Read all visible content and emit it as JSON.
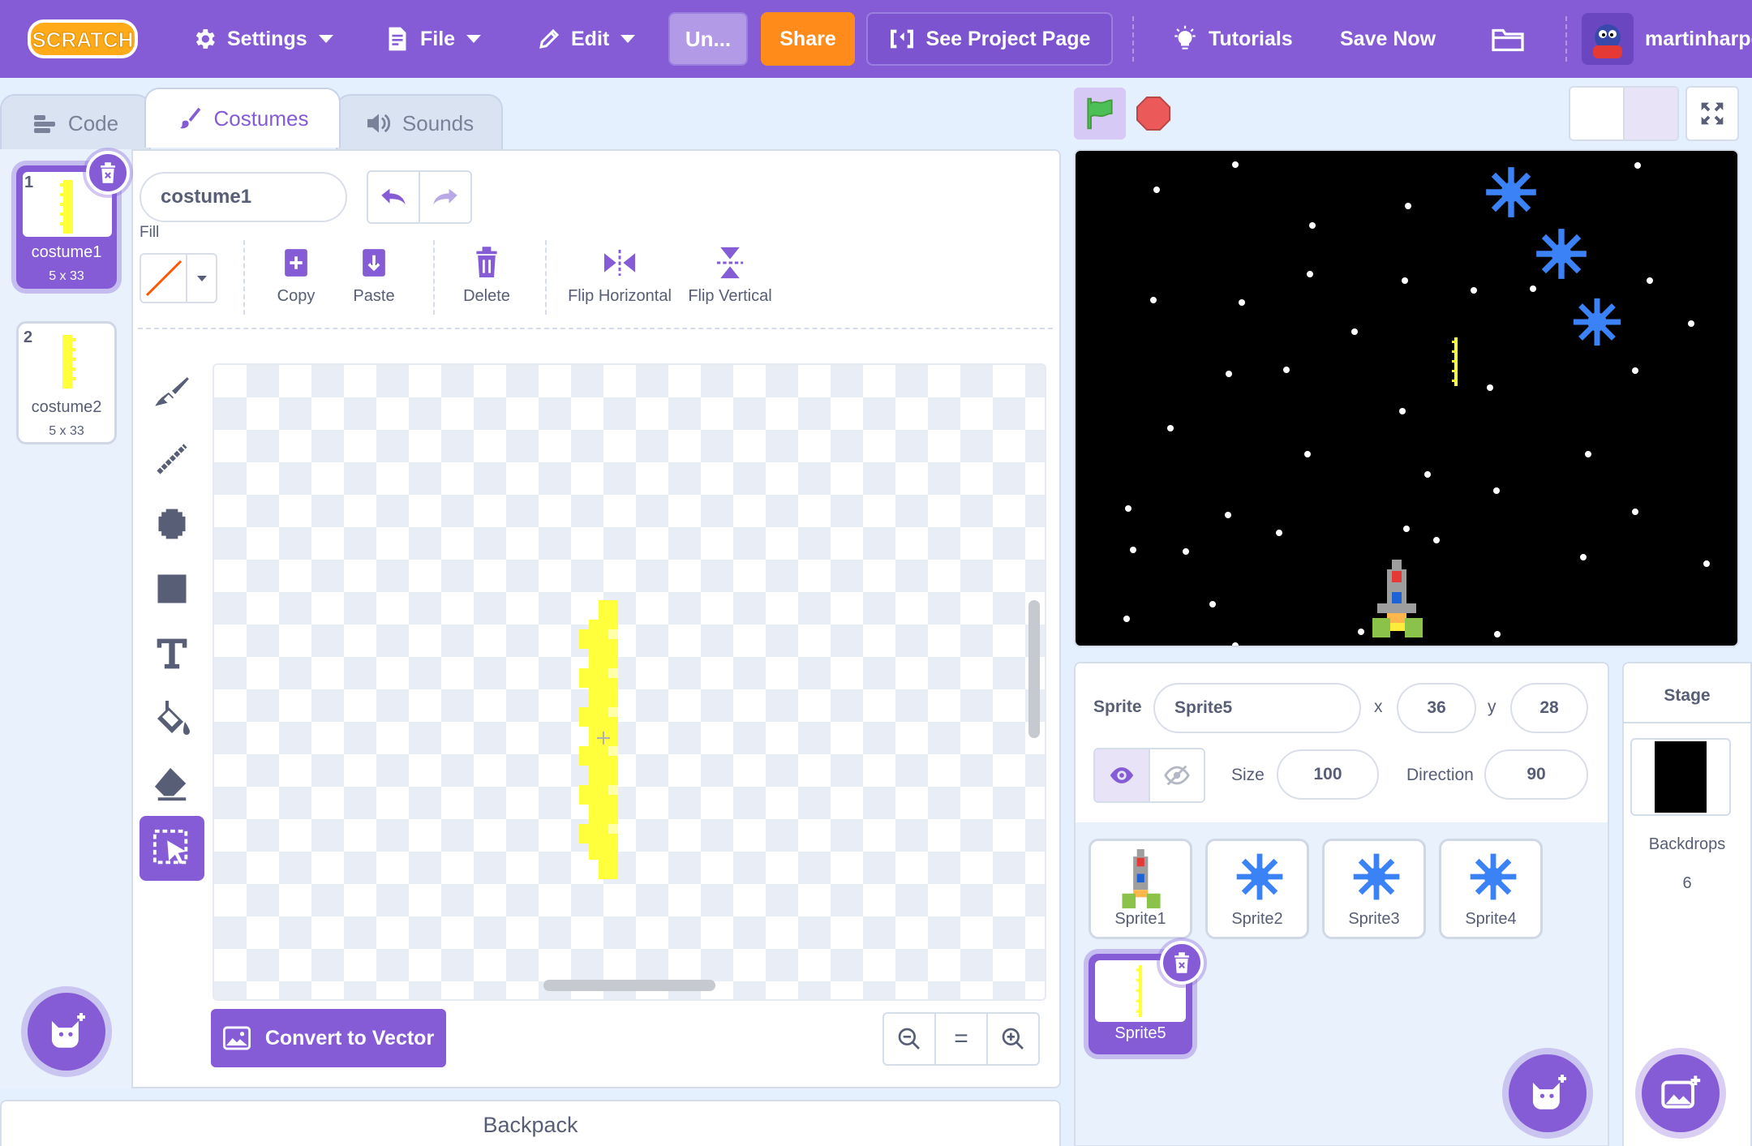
{
  "menubar": {
    "logo_text": "SCRATCH",
    "settings": "Settings",
    "file": "File",
    "edit": "Edit",
    "project_title": "Un...",
    "share": "Share",
    "see_project_page": "See Project Page",
    "tutorials": "Tutorials",
    "save_now": "Save Now",
    "username": "martinharpe"
  },
  "tabs": {
    "code": "Code",
    "costumes": "Costumes",
    "sounds": "Sounds"
  },
  "costumes": [
    {
      "number": "1",
      "name": "costume1",
      "size": "5 x 33",
      "selected": true
    },
    {
      "number": "2",
      "name": "costume2",
      "size": "5 x 33",
      "selected": false
    }
  ],
  "paint_editor": {
    "costume_name": "costume1",
    "fill_label": "Fill",
    "fill_color": "#ff5500",
    "copy": "Copy",
    "paste": "Paste",
    "delete": "Delete",
    "flip_horizontal": "Flip Horizontal",
    "flip_vertical": "Flip Vertical",
    "convert_button": "Convert to Vector",
    "zoom_reset": "="
  },
  "backpack": "Backpack",
  "sprite_info": {
    "sprite_label": "Sprite",
    "sprite_name": "Sprite5",
    "x_label": "x",
    "x_value": "36",
    "y_label": "y",
    "y_value": "28",
    "size_label": "Size",
    "size_value": "100",
    "direction_label": "Direction",
    "direction_value": "90"
  },
  "sprites": [
    {
      "name": "Sprite1",
      "icon": "rocket-icon"
    },
    {
      "name": "Sprite2",
      "icon": "snowflake-icon"
    },
    {
      "name": "Sprite3",
      "icon": "snowflake-icon"
    },
    {
      "name": "Sprite4",
      "icon": "snowflake-icon"
    },
    {
      "name": "Sprite5",
      "icon": "laser-icon",
      "selected": true
    }
  ],
  "stage_pane": {
    "title": "Stage",
    "backdrops_label": "Backdrops",
    "backdrops_count": "6"
  },
  "colors": {
    "accent": "#855cd6",
    "share": "#ff8c1a",
    "laser": "#ffff3c",
    "snowflake": "#3b82f6"
  }
}
